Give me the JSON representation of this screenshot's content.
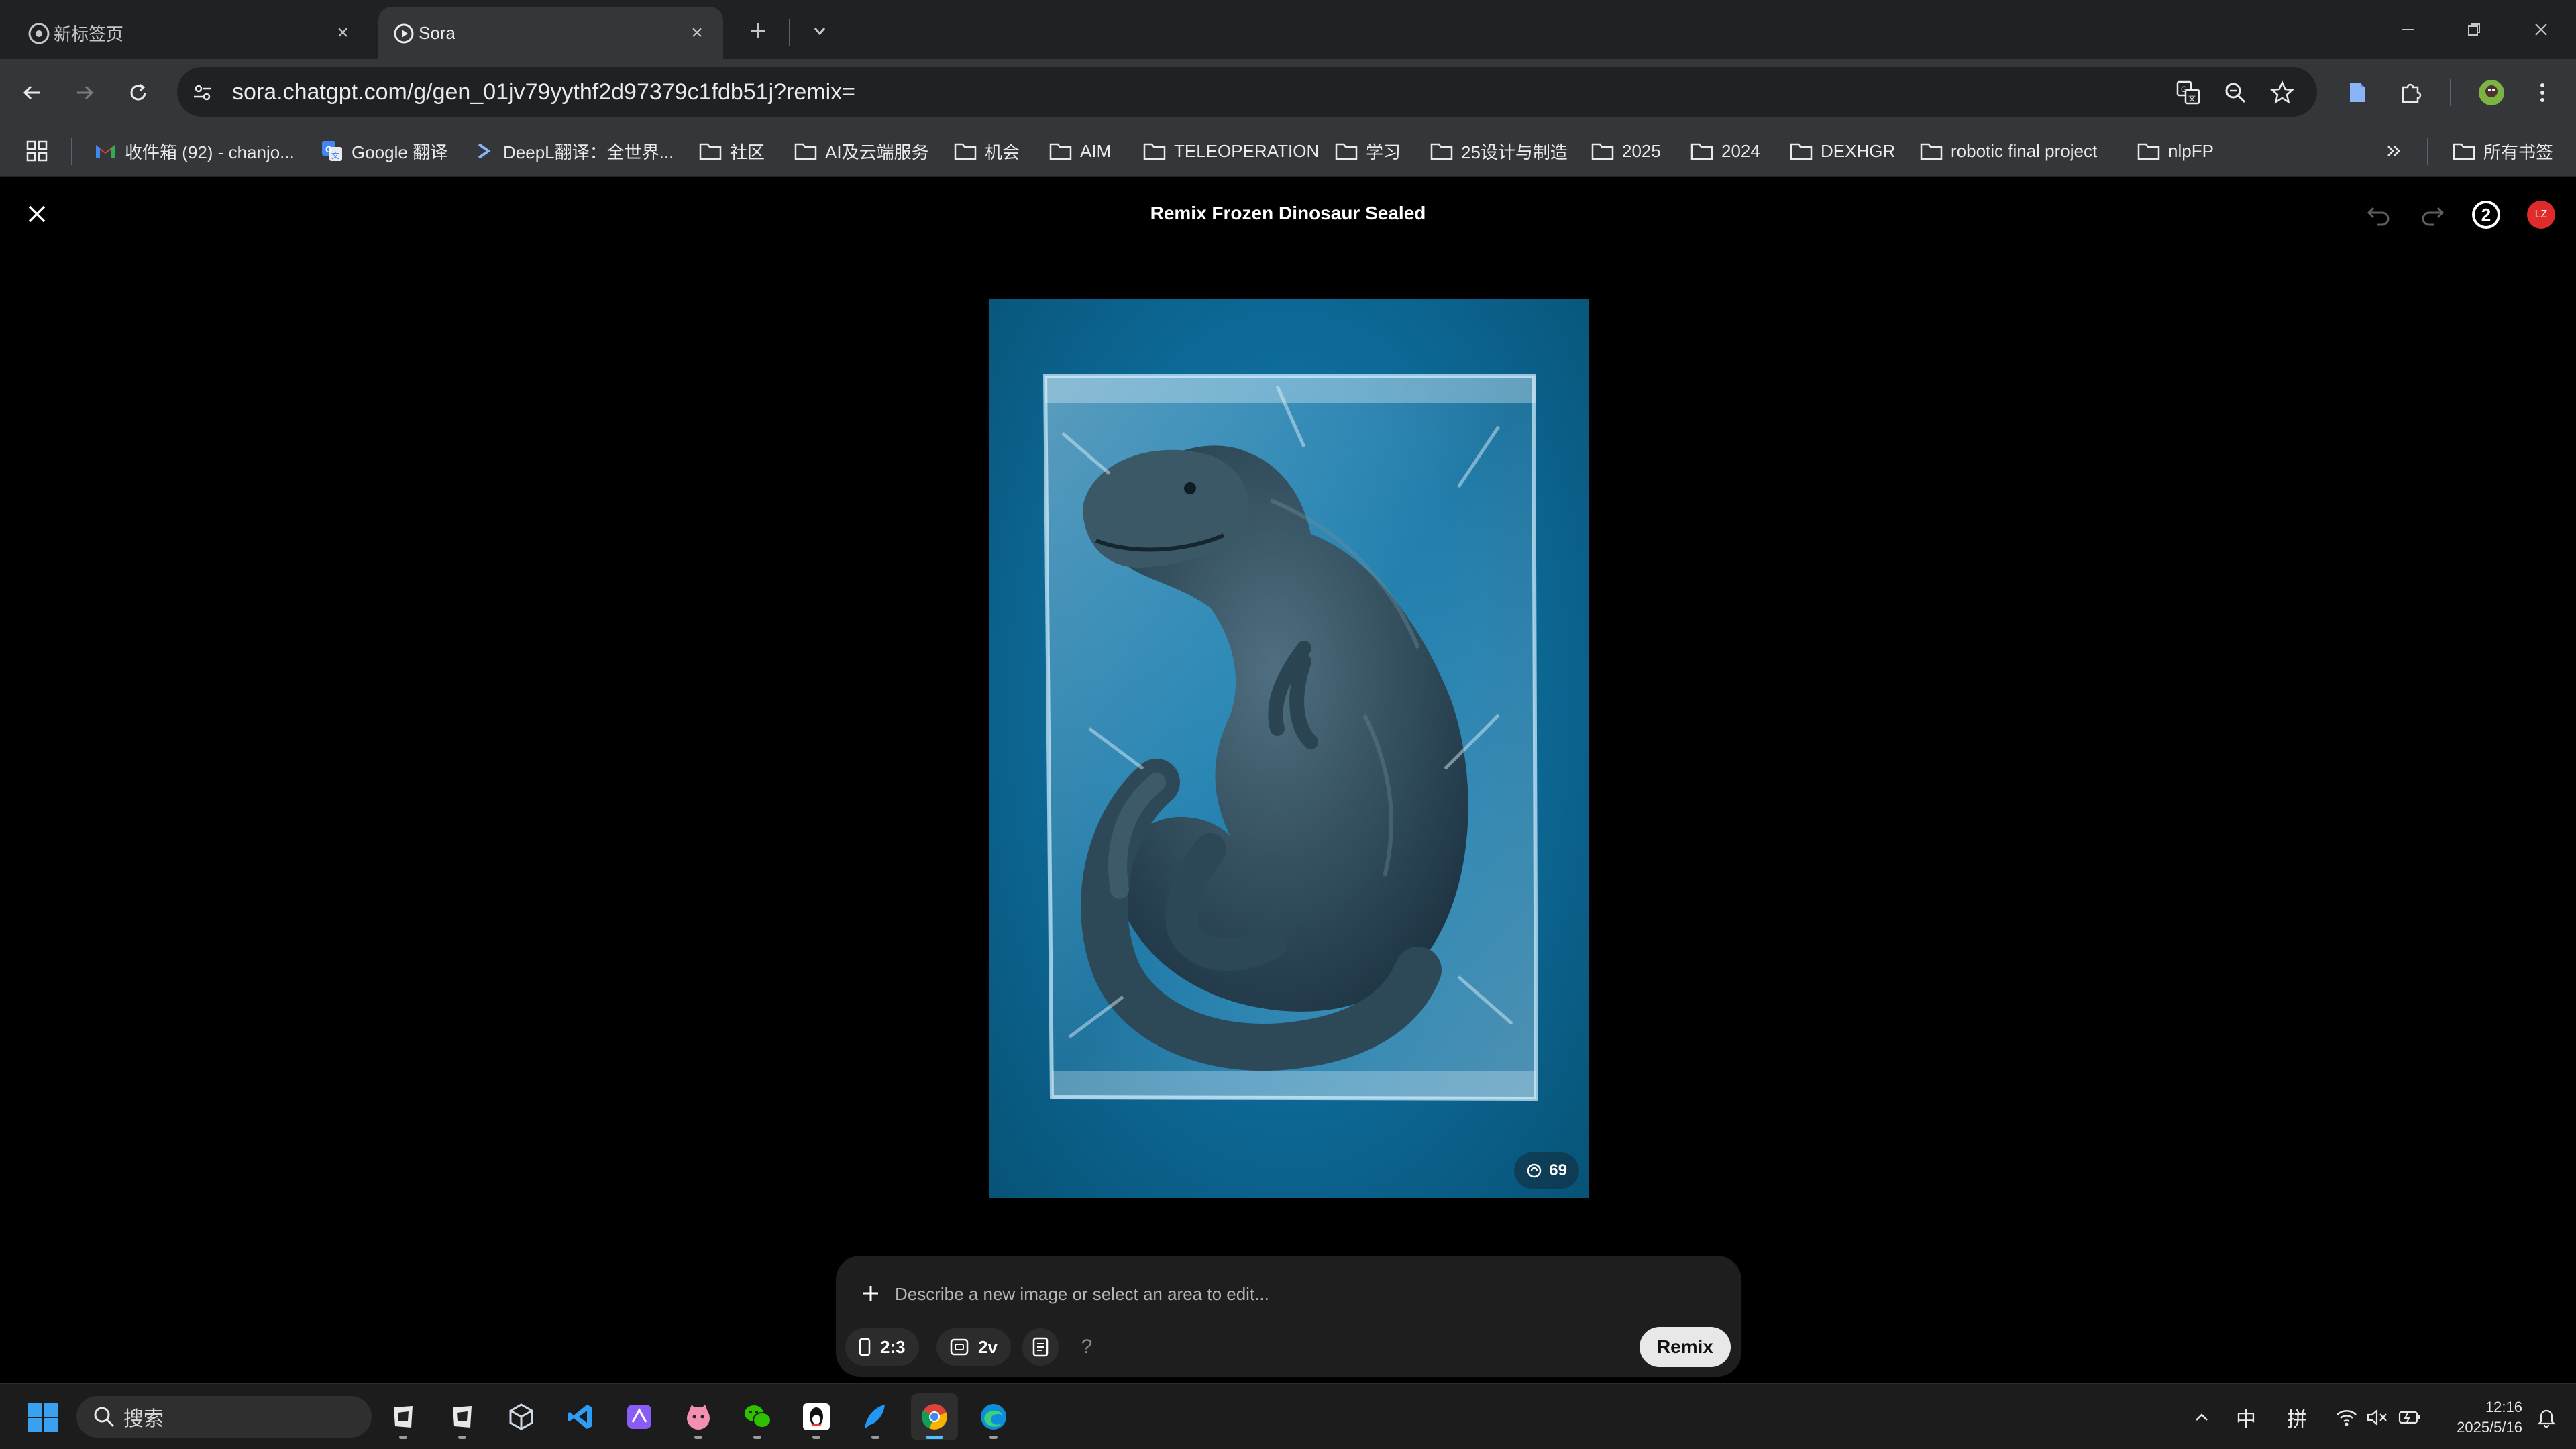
{
  "browser": {
    "tabs": [
      {
        "title": "新标签页",
        "active": false
      },
      {
        "title": "Sora",
        "active": true
      }
    ],
    "url": "sora.chatgpt.com/g/gen_01jv79yythf2d97379c1fdb51j?remix=",
    "bookmarks": [
      {
        "label": "收件箱 (92) - chanjo...",
        "icon": "gmail-icon"
      },
      {
        "label": "Google 翻译",
        "icon": "google-translate-icon"
      },
      {
        "label": "DeepL翻译：全世界...",
        "icon": "deepl-icon"
      },
      {
        "label": "社区",
        "icon": "folder-icon"
      },
      {
        "label": "AI及云端服务",
        "icon": "folder-icon"
      },
      {
        "label": "机会",
        "icon": "folder-icon"
      },
      {
        "label": "AIM",
        "icon": "folder-icon"
      },
      {
        "label": "TELEOPERATION",
        "icon": "folder-icon"
      },
      {
        "label": "学习",
        "icon": "folder-icon"
      },
      {
        "label": "25设计与制造",
        "icon": "folder-icon"
      },
      {
        "label": "2025",
        "icon": "folder-icon"
      },
      {
        "label": "2024",
        "icon": "folder-icon"
      },
      {
        "label": "DEXHGR",
        "icon": "folder-icon"
      },
      {
        "label": "robotic final project",
        "icon": "folder-icon"
      },
      {
        "label": "nlpFP",
        "icon": "folder-icon"
      }
    ],
    "all_bookmarks_label": "所有书签"
  },
  "sora": {
    "title": "Remix Frozen Dinosaur Sealed",
    "remix_count": "2",
    "avatar_initials": "LZ",
    "likes": "69",
    "composer": {
      "placeholder": "Describe a new image or select an area to edit...",
      "aspect_ratio": "2:3",
      "variations": "2v",
      "help": "?",
      "remix_label": "Remix"
    }
  },
  "taskbar": {
    "search_placeholder": "搜索",
    "apps": [
      "app-1",
      "app-2",
      "app-3",
      "vscode",
      "app-5",
      "app-6",
      "wechat",
      "qq",
      "app-9",
      "chrome",
      "edge"
    ],
    "ime_lang": "中",
    "ime_mode": "拼",
    "time": "12:16",
    "date": "2025/5/16"
  },
  "colors": {
    "accent_blue": "#0e6d9c",
    "chrome_dark": "#202124",
    "chrome_toolbar": "#35363a",
    "avatar_red": "#e02b2b"
  }
}
